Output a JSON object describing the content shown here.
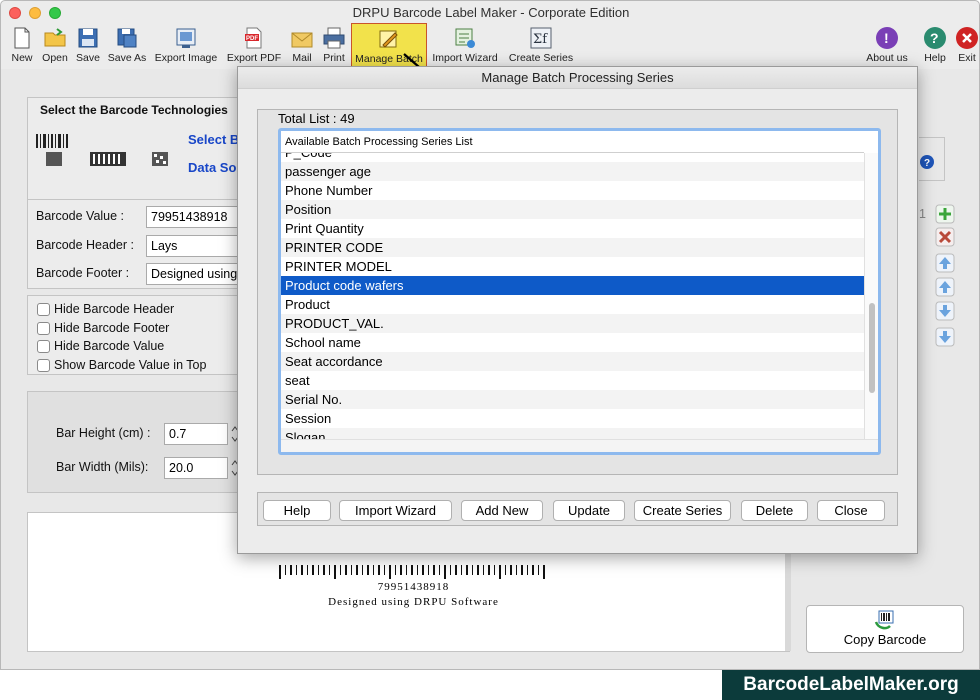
{
  "window": {
    "title": "DRPU Barcode Label Maker - Corporate Edition"
  },
  "toolbar": {
    "items": [
      {
        "label": "New"
      },
      {
        "label": "Open"
      },
      {
        "label": "Save"
      },
      {
        "label": "Save As"
      },
      {
        "label": "Export Image"
      },
      {
        "label": "Export PDF"
      },
      {
        "label": "Mail"
      },
      {
        "label": "Print"
      },
      {
        "label": "Manage Batch"
      },
      {
        "label": "Import Wizard"
      },
      {
        "label": "Create Series"
      }
    ],
    "right_items": [
      {
        "label": "About us"
      },
      {
        "label": "Help"
      },
      {
        "label": "Exit"
      }
    ]
  },
  "left_panel": {
    "technologies_title": "Select the Barcode Technologies",
    "select_link": "Select B",
    "data_source_link": "Data So",
    "barcode_value_label": "Barcode Value :",
    "barcode_value": "79951438918",
    "barcode_header_label": "Barcode Header :",
    "barcode_header": "Lays",
    "barcode_footer_label": "Barcode Footer :",
    "barcode_footer": "Designed using",
    "checkboxes": [
      {
        "label": "Hide Barcode Header"
      },
      {
        "label": "Hide Barcode Footer"
      },
      {
        "label": "Hide Barcode Value"
      },
      {
        "label": "Show Barcode Value in Top"
      }
    ],
    "bar_height_label": "Bar Height (cm) :",
    "bar_height": "0.7",
    "bar_width_label": "Bar Width (Mils):",
    "bar_width": "20.0",
    "side_number": "1"
  },
  "dialog": {
    "title": "Manage Batch Processing Series",
    "total_list": "Total List : 49",
    "list_header": "Available Batch Processing Series List",
    "rows": [
      {
        "label": "P_Code"
      },
      {
        "label": "passenger age"
      },
      {
        "label": "Phone Number"
      },
      {
        "label": "Position"
      },
      {
        "label": "Print Quantity"
      },
      {
        "label": "PRINTER CODE"
      },
      {
        "label": "PRINTER MODEL"
      },
      {
        "label": "Product code wafers"
      },
      {
        "label": "Product"
      },
      {
        "label": "PRODUCT_VAL."
      },
      {
        "label": "School name"
      },
      {
        "label": "Seat accordance"
      },
      {
        "label": "seat"
      },
      {
        "label": "Serial No."
      },
      {
        "label": "Session"
      },
      {
        "label": "Slogan"
      }
    ],
    "selected_index": 7,
    "buttons": {
      "help": "Help",
      "import_wizard": "Import Wizard",
      "add_new": "Add New",
      "update": "Update",
      "create_series": "Create Series",
      "delete": "Delete",
      "close": "Close"
    }
  },
  "preview": {
    "barcode_value": "79951438918",
    "footer": "Designed using DRPU Software"
  },
  "copy_barcode": {
    "label": "Copy Barcode"
  },
  "watermark": "BarcodeLabelMaker.org",
  "colors": {
    "selection": "#0e5ac8",
    "active_tool": "#f2e24b",
    "accent_link": "#1846c8"
  }
}
